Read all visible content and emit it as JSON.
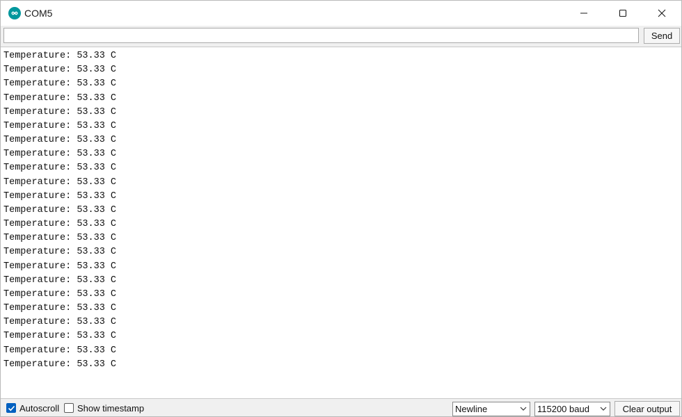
{
  "window": {
    "title": "COM5",
    "icon": "arduino-infinity-icon"
  },
  "controls": {
    "minimize_icon": "minimize-icon",
    "maximize_icon": "maximize-icon",
    "close_icon": "close-icon"
  },
  "send_bar": {
    "input_value": "",
    "send_label": "Send"
  },
  "output": {
    "lines": [
      "Temperature: 53.33 C",
      "Temperature: 53.33 C",
      "Temperature: 53.33 C",
      "Temperature: 53.33 C",
      "Temperature: 53.33 C",
      "Temperature: 53.33 C",
      "Temperature: 53.33 C",
      "Temperature: 53.33 C",
      "Temperature: 53.33 C",
      "Temperature: 53.33 C",
      "Temperature: 53.33 C",
      "Temperature: 53.33 C",
      "Temperature: 53.33 C",
      "Temperature: 53.33 C",
      "Temperature: 53.33 C",
      "Temperature: 53.33 C",
      "Temperature: 53.33 C",
      "Temperature: 53.33 C",
      "Temperature: 53.33 C",
      "Temperature: 53.33 C",
      "Temperature: 53.33 C",
      "Temperature: 53.33 C",
      "Temperature: 53.33 C"
    ]
  },
  "bottom_bar": {
    "autoscroll": {
      "label": "Autoscroll",
      "checked": true
    },
    "show_timestamp": {
      "label": "Show timestamp",
      "checked": false
    },
    "line_ending": {
      "selected": "Newline"
    },
    "baud_rate": {
      "selected": "115200 baud"
    },
    "clear_label": "Clear output"
  },
  "colors": {
    "accent": "#0060c0",
    "arduino_teal": "#00979d"
  }
}
